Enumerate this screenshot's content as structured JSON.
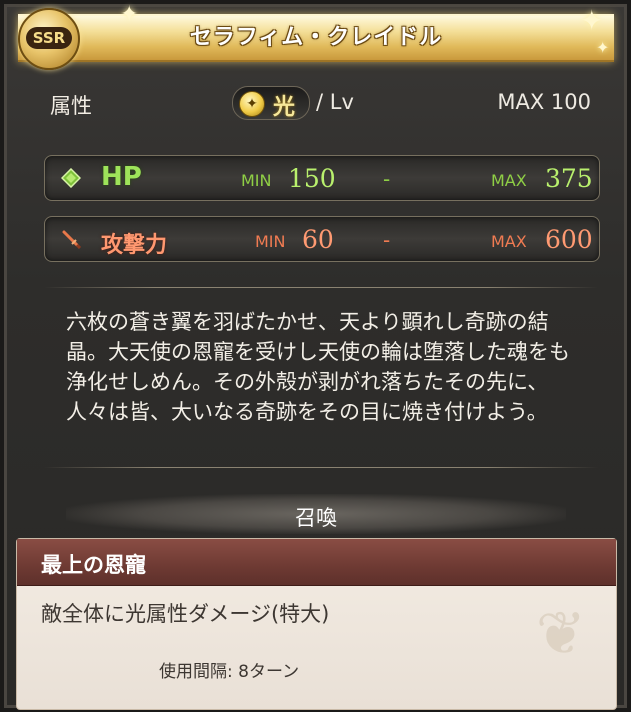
{
  "card": {
    "rarity": "SSR",
    "title": "セラフィム・クレイドル"
  },
  "attributes": {
    "label": "属性",
    "element": "光",
    "level_label": "/ Lv",
    "max_level": "MAX 100"
  },
  "stats": {
    "hp": {
      "name": "HP",
      "min_label": "MIN",
      "min_value": "150",
      "separator": "-",
      "max_label": "MAX",
      "max_value": "375",
      "color": "#9ee35a"
    },
    "attack": {
      "name": "攻撃力",
      "min_label": "MIN",
      "min_value": "60",
      "separator": "-",
      "max_label": "MAX",
      "max_value": "600",
      "color": "#ff9870"
    }
  },
  "flavor_text": "六枚の蒼き翼を羽ばたかせ、天より顕れし奇跡の結晶。大天使の恩寵を受けし天使の輪は堕落した魂をも浄化せしめん。その外殻が剥がれ落ちたその先に、人々は皆、大いなる奇跡をその目に焼き付けよう。",
  "summon": {
    "header": "召喚",
    "skill_name": "最上の恩寵",
    "skill_description": "敵全体に光属性ダメージ(特大)",
    "cooldown": "使用間隔: 8ターン"
  }
}
